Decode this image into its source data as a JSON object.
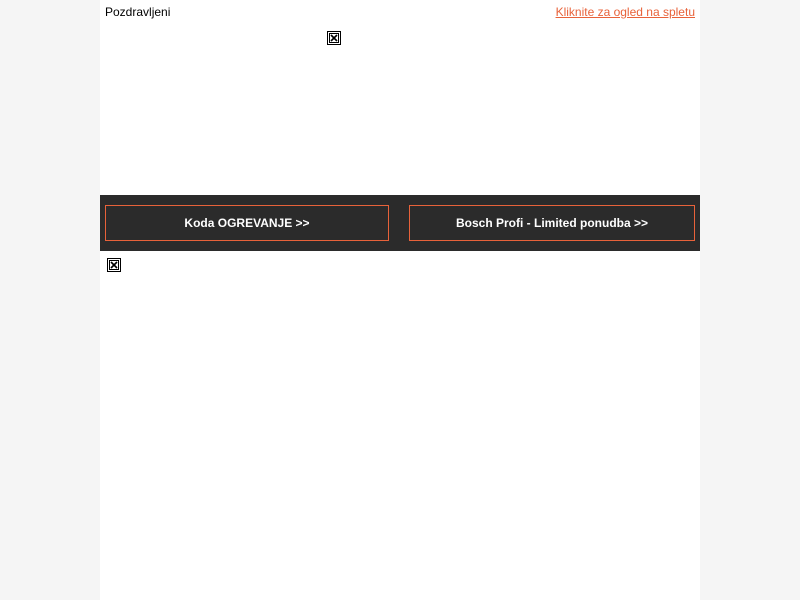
{
  "header": {
    "greeting": "Pozdravljeni",
    "view_online_link": "Kliknite za ogled na spletu"
  },
  "images": {
    "hero_icon": "broken-image-icon",
    "lower_icon": "broken-image-icon"
  },
  "cta_bar": {
    "buttons": [
      {
        "label": "Koda OGREVANJE >>"
      },
      {
        "label": "Bosch Profi - Limited ponudba >>"
      }
    ]
  },
  "colors": {
    "accent": "#e8623a",
    "bar_background": "#2b2b2b",
    "page_background": "#f5f5f5",
    "content_background": "#ffffff"
  }
}
